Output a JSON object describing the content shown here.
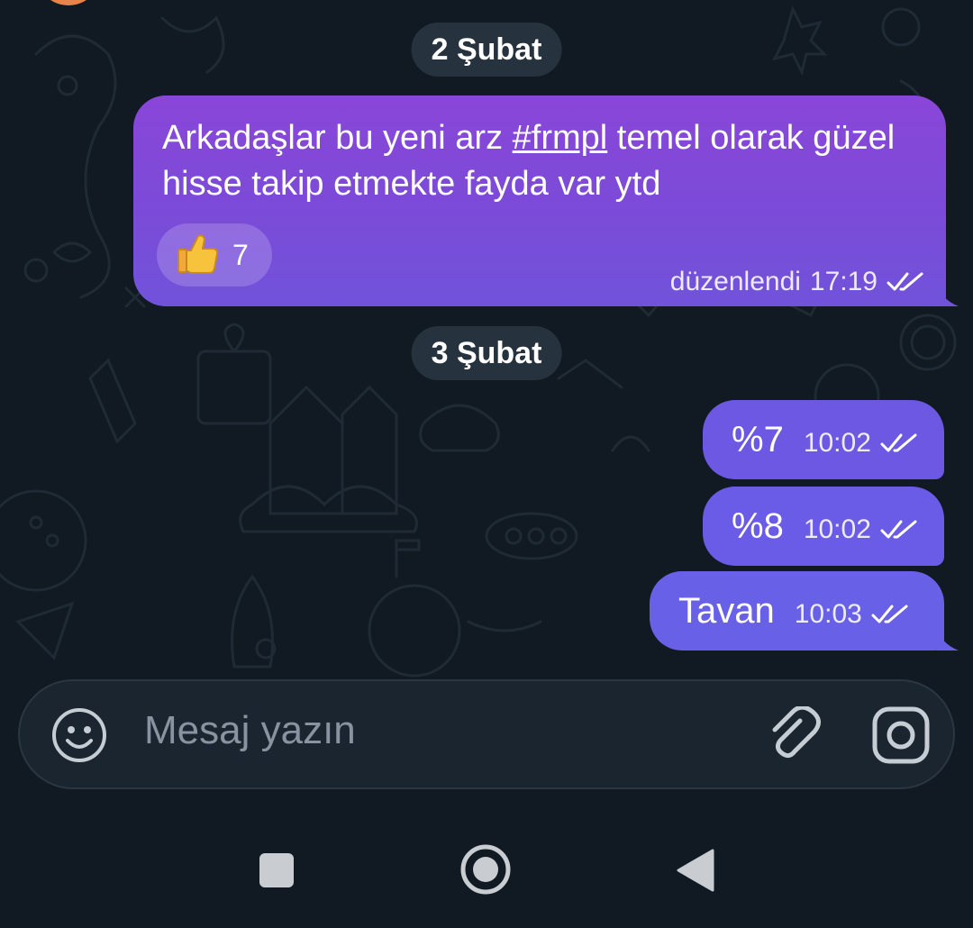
{
  "dates": [
    "2 Şubat",
    "3 Şubat"
  ],
  "messages": [
    {
      "text_before": "Arkadaşlar bu yeni arz ",
      "hashtag": "#frmpl",
      "text_after": " temel olarak güzel hisse takip etmekte fayda var ytd",
      "reaction_emoji": "👍",
      "reaction_count": "7",
      "status": "düzenlendi",
      "time": "17:19"
    },
    {
      "text": "%7",
      "time": "10:02"
    },
    {
      "text": "%8",
      "time": "10:02"
    },
    {
      "text": "Tavan",
      "time": "10:03"
    }
  ],
  "composer": {
    "placeholder": "Mesaj yazın"
  },
  "icons": {
    "emoji": "smiley-icon",
    "attach": "paperclip-icon",
    "camera": "camera-icon",
    "read": "double-check-icon",
    "nav_recent": "square-icon",
    "nav_home": "circle-icon",
    "nav_back": "triangle-back-icon"
  },
  "colors": {
    "background": "#111a22",
    "bubble_gradient_start": "#8a46d8",
    "bubble_gradient_end": "#6861e8",
    "date_chip": "#26323d"
  }
}
